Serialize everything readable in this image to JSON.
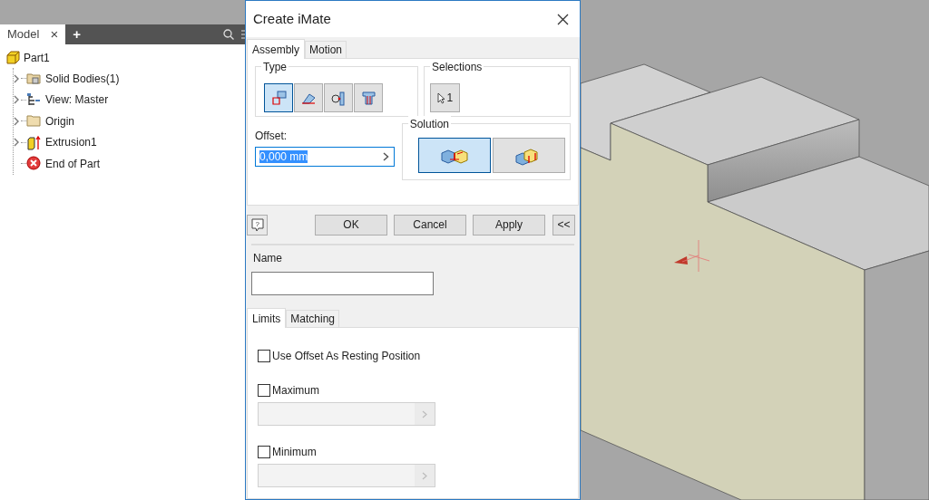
{
  "browser": {
    "tab": "Model",
    "close": "×",
    "add": "+"
  },
  "tree": {
    "label": "Part1",
    "kind": "part",
    "children": [
      {
        "label": "Solid Bodies(1)",
        "kind": "bodies",
        "expandable": true
      },
      {
        "label": "View: Master",
        "kind": "view",
        "expandable": true
      },
      {
        "label": "Origin",
        "kind": "folder",
        "expandable": true
      },
      {
        "label": "Extrusion1",
        "kind": "extrusion",
        "expandable": true
      },
      {
        "label": "End of Part",
        "kind": "end",
        "expandable": false
      }
    ]
  },
  "dialog": {
    "title": "Create iMate",
    "tabs": [
      {
        "label": "Assembly",
        "selected": true
      },
      {
        "label": "Motion",
        "selected": false
      }
    ],
    "type_label": "Type",
    "types": [
      {
        "kind": "mate",
        "selected": true
      },
      {
        "kind": "angle",
        "selected": false
      },
      {
        "kind": "tangent",
        "selected": false
      },
      {
        "kind": "insert",
        "selected": false
      }
    ],
    "selections_label": "Selections",
    "selection_count": "1",
    "offset_label": "Offset:",
    "offset_value": "0,000 mm",
    "solution_label": "Solution",
    "solutions": [
      {
        "kind": "mate",
        "selected": true
      },
      {
        "kind": "flush",
        "selected": false
      }
    ],
    "buttons": [
      "OK",
      "Cancel",
      "Apply"
    ],
    "more": "<<",
    "help": "?",
    "name_label": "Name",
    "lower_tabs": [
      {
        "label": "Limits",
        "selected": true
      },
      {
        "label": "Matching",
        "selected": false
      }
    ],
    "options": [
      {
        "label": "Use Offset As Resting Position",
        "checked": false,
        "has_field": false
      },
      {
        "label": "Maximum",
        "checked": false,
        "has_field": true,
        "disabled": true
      },
      {
        "label": "Minimum",
        "checked": false,
        "has_field": true,
        "disabled": true
      }
    ]
  }
}
